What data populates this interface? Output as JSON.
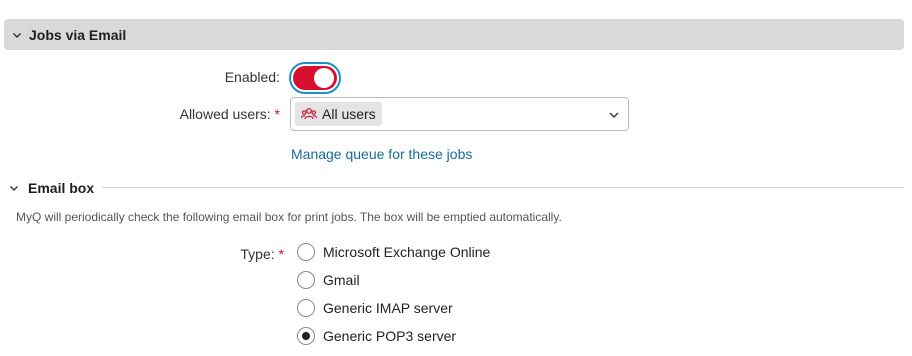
{
  "section": {
    "title": "Jobs via Email"
  },
  "enabled": {
    "label": "Enabled:",
    "value": true
  },
  "allowed_users": {
    "label": "Allowed users:",
    "required_mark": "*",
    "selected": "All users"
  },
  "manage_link": "Manage queue for these jobs",
  "email_box": {
    "title": "Email box",
    "description": "MyQ will periodically check the following email box for print jobs. The box will be emptied automatically.",
    "type_label": "Type:",
    "required_mark": "*",
    "options": [
      {
        "label": "Microsoft Exchange Online",
        "checked": false
      },
      {
        "label": "Gmail",
        "checked": false
      },
      {
        "label": "Generic IMAP server",
        "checked": false
      },
      {
        "label": "Generic POP3 server",
        "checked": true
      }
    ]
  },
  "colors": {
    "accent": "#d60f2e",
    "focus": "#1a8fc9",
    "link": "#1a6b9a"
  },
  "icons": {
    "collapse": "chevron-down-icon",
    "users": "users-icon",
    "dropdown": "chevron-down-icon"
  }
}
